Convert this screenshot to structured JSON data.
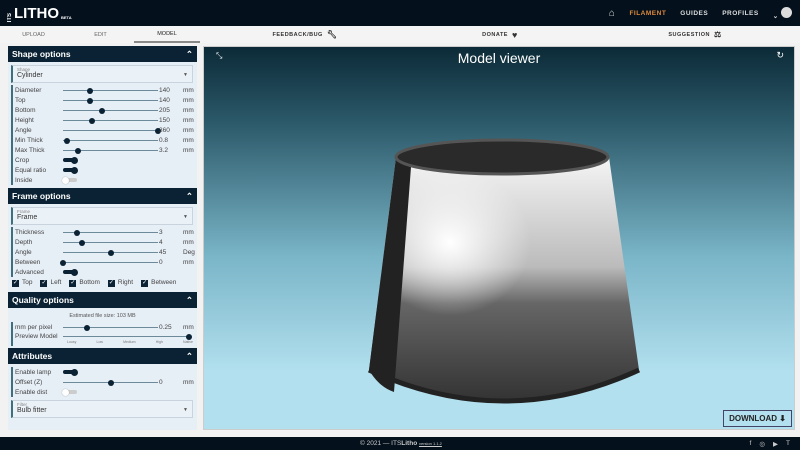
{
  "header": {
    "logo_its": "ITS",
    "logo": "LITHO",
    "logo_beta": "BETA",
    "nav": [
      "FILAMENT",
      "GUIDES",
      "PROFILES"
    ]
  },
  "tabs": {
    "upload": "UPLOAD",
    "edit": "EDIT",
    "model": "MODEL",
    "feedback": "FEEDBACK/BUG",
    "donate": "DONATE",
    "suggestion": "SUGGESTION"
  },
  "shape": {
    "title": "Shape options",
    "select_label": "Shape",
    "select_value": "Cylinder",
    "rows": [
      {
        "label": "Diameter",
        "value": "140",
        "unit": "mm",
        "pos": 0.28
      },
      {
        "label": "Top",
        "value": "140",
        "unit": "mm",
        "pos": 0.28
      },
      {
        "label": "Bottom",
        "value": "205",
        "unit": "mm",
        "pos": 0.41
      },
      {
        "label": "Height",
        "value": "150",
        "unit": "mm",
        "pos": 0.3
      },
      {
        "label": "Angle",
        "value": "360",
        "unit": "mm",
        "pos": 1.0
      },
      {
        "label": "Min Thick",
        "value": "0.8",
        "unit": "mm",
        "pos": 0.04
      },
      {
        "label": "Max Thick",
        "value": "3.2",
        "unit": "mm",
        "pos": 0.16
      }
    ],
    "toggles": [
      {
        "label": "Crop",
        "on": true
      },
      {
        "label": "Equal ratio",
        "on": true
      },
      {
        "label": "Inside",
        "on": false
      }
    ]
  },
  "frame": {
    "title": "Frame options",
    "select_label": "Frame",
    "select_value": "Frame",
    "rows": [
      {
        "label": "Thickness",
        "value": "3",
        "unit": "mm",
        "pos": 0.15
      },
      {
        "label": "Depth",
        "value": "4",
        "unit": "mm",
        "pos": 0.2
      },
      {
        "label": "Angle",
        "value": "45",
        "unit": "Deg",
        "pos": 0.5
      },
      {
        "label": "Between",
        "value": "0",
        "unit": "mm",
        "pos": 0.0
      }
    ],
    "advanced": "Advanced",
    "checks": [
      "Top",
      "Left",
      "Bottom",
      "Right",
      "Between"
    ]
  },
  "quality": {
    "title": "Quality options",
    "file_size": "Estimated file size: 103 MB",
    "mm_label": "mm per pixel",
    "mm_value": "0.25",
    "mm_unit": "mm",
    "mm_pos": 0.25,
    "preview_label": "Preview Model",
    "preview_ticks": [
      "Lousy",
      "Low",
      "Medium",
      "High",
      "Native"
    ],
    "preview_pos": 1.0
  },
  "attributes": {
    "title": "Attributes",
    "lamp": "Enable lamp",
    "offset_label": "Offset (Z)",
    "offset_value": "0",
    "offset_unit": "mm",
    "offset_pos": 0.5,
    "dist": "Enable dist",
    "filter_label": "Filter",
    "filter_value": "Bulb fitter"
  },
  "viewer": {
    "title": "Model viewer",
    "download": "DOWNLOAD"
  },
  "footer": {
    "text": "© 2021 — ITS",
    "brand": "Litho",
    "version": "version 1.1.2"
  }
}
